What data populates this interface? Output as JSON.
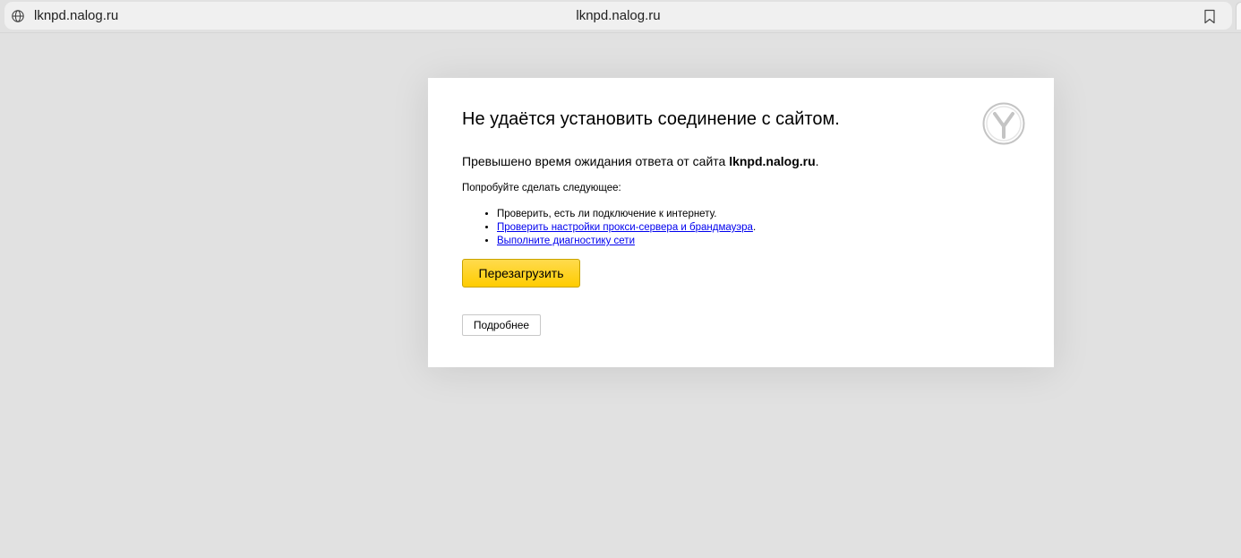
{
  "browser": {
    "url_left": "lknpd.nalog.ru",
    "url_center": "lknpd.nalog.ru"
  },
  "error": {
    "heading": "Не удаётся установить соединение с сайтом.",
    "summary_prefix": "Превышено время ожидания ответа от сайта ",
    "summary_host": "lknpd.nalog.ru",
    "summary_suffix": ".",
    "suggest_title": "Попробуйте сделать следующее:",
    "suggestions": [
      {
        "text": "Проверить, есть ли подключение к интернету."
      },
      {
        "link": "Проверить настройки прокси-сервера и брандмауэра",
        "suffix": "."
      },
      {
        "link": "Выполните диагностику сети"
      }
    ],
    "reload_label": "Перезагрузить",
    "details_label": "Подробнее"
  },
  "colors": {
    "page_background": "#e1e1e1",
    "reload_button": "#ffcc00",
    "link": "#0000ee"
  },
  "icons": {
    "site_info": "globe-icon",
    "bookmark": "bookmark-icon",
    "brand": "yandex-logo"
  }
}
